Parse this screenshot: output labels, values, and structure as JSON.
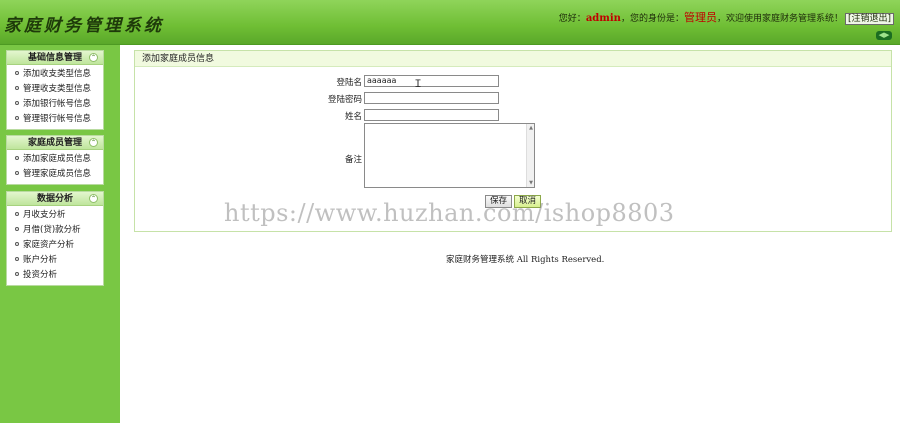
{
  "header": {
    "logo": "家庭财务管理系统",
    "greeting": "您好：",
    "username": "admin",
    "role_prefix": "，您的身份是：",
    "role": "管理员",
    "welcome": "，欢迎使用家庭财务管理系统！",
    "logout": "[注销退出]",
    "nav_arrows": "◀▶"
  },
  "sidebar": [
    {
      "title": "基础信息管理",
      "collapse": "⌃",
      "items": [
        "添加收支类型信息",
        "管理收支类型信息",
        "添加银行帐号信息",
        "管理银行帐号信息"
      ]
    },
    {
      "title": "家庭成员管理",
      "collapse": "⌃",
      "items": [
        "添加家庭成员信息",
        "管理家庭成员信息"
      ]
    },
    {
      "title": "数据分析",
      "collapse": "⌃",
      "items": [
        "月收支分析",
        "月借(贷)款分析",
        "家庭资产分析",
        "账户分析",
        "投资分析"
      ]
    }
  ],
  "form": {
    "title": "添加家庭成员信息",
    "login_label": "登陆名",
    "login_value": "aaaaaa",
    "password_label": "登陆密码",
    "name_label": "姓名",
    "remark_label": "备注",
    "save": "保存",
    "cancel": "取消"
  },
  "watermark": "https://www.huzhan.com/ishop8803",
  "footer": "家庭财务管理系统 All Rights Reserved."
}
